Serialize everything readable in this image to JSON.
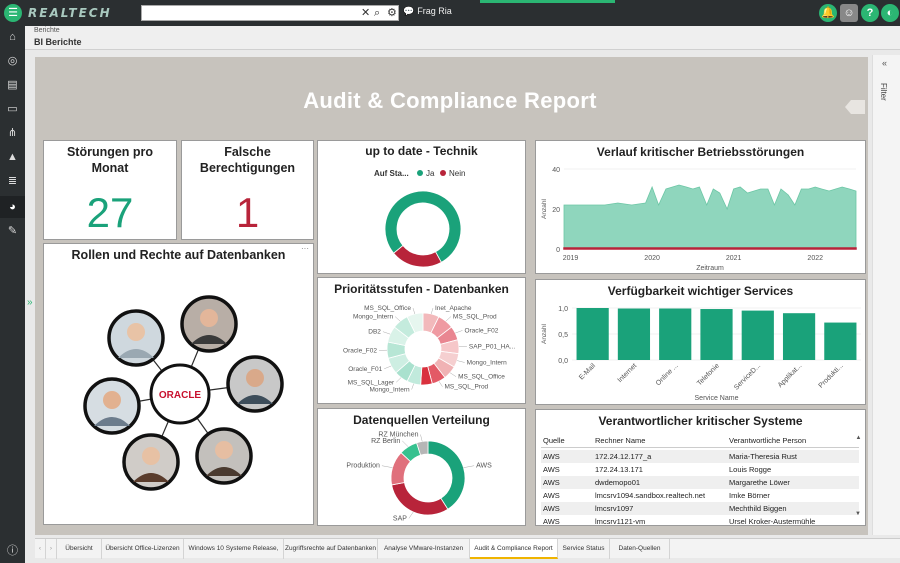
{
  "app": {
    "logo": "REALTECH",
    "search_placeholder": "",
    "ask_label": "Frag Ria"
  },
  "breadcrumb": {
    "parent": "Berichte",
    "current": "BI Berichte"
  },
  "report": {
    "title": "Audit & Compliance Report",
    "filter_label": "Filter"
  },
  "kpis": {
    "stoerungen": {
      "title_line1": "Störungen pro",
      "title_line2": "Monat",
      "value": "27",
      "color": "#1aa27a"
    },
    "berechtigungen": {
      "title_line1": "Falsche",
      "title_line2": "Berechtigungen",
      "value": "1",
      "color": "#b8243a"
    }
  },
  "rollen": {
    "title": "Rollen und Rechte auf Datenbanken",
    "center_logo": "ORACLE"
  },
  "colors": {
    "green": "#1aa27a",
    "red": "#b8243a",
    "teal_area": "#8fd6bd"
  },
  "chart_data": [
    {
      "id": "up-to-date",
      "type": "pie",
      "title": "up to date - Technik",
      "legend_title": "Auf Sta...",
      "legend": [
        "Ja",
        "Nein"
      ],
      "slices": [
        {
          "name": "Ja",
          "value": 78,
          "color": "#1aa27a"
        },
        {
          "name": "Nein",
          "value": 22,
          "color": "#b8243a"
        }
      ]
    },
    {
      "id": "verlauf",
      "type": "area",
      "title": "Verlauf kritischer Betriebsstörungen",
      "xlabel": "Zeitraum",
      "ylabel": "Anzahl",
      "x_ticks": [
        "2019",
        "2020",
        "2021",
        "2022"
      ],
      "y_ticks": [
        "0",
        "20",
        "40"
      ],
      "ylim": [
        0,
        40
      ],
      "x_range": [
        2018.92,
        2022.5
      ],
      "x": [
        2018.92,
        2019.08,
        2019.25,
        2019.42,
        2019.58,
        2019.75,
        2019.92,
        2020.0,
        2020.08,
        2020.17,
        2020.25,
        2020.33,
        2020.42,
        2020.5,
        2020.58,
        2020.67,
        2020.75,
        2020.83,
        2020.92,
        2021.0,
        2021.08,
        2021.17,
        2021.25,
        2021.33,
        2021.42,
        2021.5,
        2021.58,
        2021.67,
        2021.75,
        2021.83,
        2021.92,
        2022.0,
        2022.08,
        2022.17,
        2022.25,
        2022.33,
        2022.42,
        2022.5
      ],
      "series": [
        {
          "values": [
            22,
            22,
            22,
            22,
            23,
            22,
            23,
            31,
            22,
            30,
            31,
            32,
            31,
            30,
            31,
            22,
            30,
            28,
            20,
            30,
            31,
            28,
            29,
            30,
            30,
            22,
            30,
            27,
            22,
            30,
            30,
            31,
            30,
            29,
            30,
            31,
            30,
            29
          ],
          "color": "#8fd6bd"
        },
        {
          "values": [
            0.5,
            0.5,
            0.5,
            0.5,
            0.5,
            0.5,
            0.5,
            0.5,
            0.5,
            0.5,
            0.5,
            0.5,
            0.5,
            0.5,
            0.5,
            0.5,
            0.5,
            0.5,
            0.5,
            0.5,
            0.5,
            0.5,
            0.5,
            0.5,
            0.5,
            0.5,
            0.5,
            0.5,
            0.5,
            0.5,
            0.5,
            0.5,
            0.5,
            0.5,
            0.5,
            0.5,
            0.5,
            0.5
          ],
          "color": "#b8243a"
        }
      ]
    },
    {
      "id": "prioritaet",
      "type": "pie",
      "title": "Prioritätsstufen - Datenbanken",
      "slices": [
        {
          "name": "Inet_Apache",
          "value": 7,
          "color": "#f2b9bb"
        },
        {
          "name": "MS_SQL_Prod",
          "value": 7,
          "color": "#ef9aa2"
        },
        {
          "name": "Oracle_F02",
          "value": 6,
          "color": "#e98691"
        },
        {
          "name": "SAP_P01_HA...",
          "value": 6,
          "color": "#f6c7c9"
        },
        {
          "name": "Mongo_Intern",
          "value": 6,
          "color": "#f5cfd0"
        },
        {
          "name": "MS_SQL_Office",
          "value": 6,
          "color": "#f0b2b4"
        },
        {
          "name": "MS_SQL_Prod",
          "value": 6,
          "color": "#e35a66"
        },
        {
          "name": "",
          "value": 5,
          "color": "#d9313e"
        },
        {
          "name": "Mongo_Intern",
          "value": 6,
          "color": "#c1eadc"
        },
        {
          "name": "MS_SQL_Lager",
          "value": 6,
          "color": "#a9e1ce"
        },
        {
          "name": "Oracle_F01",
          "value": 7,
          "color": "#cdeee2"
        },
        {
          "name": "Oracle_F02",
          "value": 7,
          "color": "#b7e6d5"
        },
        {
          "name": "DB2",
          "value": 7,
          "color": "#d9f2e8"
        },
        {
          "name": "Mongo_Intern",
          "value": 7,
          "color": "#c4ebdd"
        },
        {
          "name": "MS_SQL_Office",
          "value": 7,
          "color": "#e6f6ef"
        }
      ]
    },
    {
      "id": "verfuegbarkeit",
      "type": "bar",
      "title": "Verfügbarkeit wichtiger Services",
      "xlabel": "Service Name",
      "ylabel": "Anzahl",
      "y_ticks": [
        "0,0",
        "0,5",
        "1,0"
      ],
      "ylim": [
        0,
        1
      ],
      "categories": [
        "E-Mail",
        "Internet",
        "Online ...",
        "Telefonie",
        "ServiceD...",
        "Applikat...",
        "Produkti..."
      ],
      "values": [
        1.0,
        0.99,
        0.99,
        0.98,
        0.95,
        0.9,
        0.72
      ],
      "color": "#1aa27a"
    },
    {
      "id": "datenquellen",
      "type": "pie",
      "title": "Datenquellen Verteilung",
      "slices": [
        {
          "name": "AWS",
          "value": 41,
          "color": "#1aa27a"
        },
        {
          "name": "SAP",
          "value": 31,
          "color": "#b8243a"
        },
        {
          "name": "Produktion",
          "value": 15,
          "color": "#e0707c"
        },
        {
          "name": "RZ Berlin",
          "value": 8,
          "color": "#36c18f"
        },
        {
          "name": "RZ München",
          "value": 5,
          "color": "#b6b6b6"
        }
      ]
    }
  ],
  "verantwortlicher": {
    "title": "Verantwortlicher kritischer Systeme",
    "columns": [
      "Quelle",
      "Rechner Name",
      "Verantwortliche Person"
    ],
    "rows": [
      [
        "AWS",
        "172.24.12.177_a",
        "Maria-Theresia Rust"
      ],
      [
        "AWS",
        "172.24.13.171",
        "Louis Rogge"
      ],
      [
        "AWS",
        "dwdemopo01",
        "Margarethe Löwer"
      ],
      [
        "AWS",
        "lmcsrv1094.sandbox.realtech.net",
        "Imke Börner"
      ],
      [
        "AWS",
        "lmcsrv1097",
        "Mechthild Biggen"
      ],
      [
        "AWS",
        "lmcsrv1121-vm",
        "Ursel Kroker-Austermühle"
      ]
    ]
  },
  "tabs": [
    "Übersicht",
    "Übersicht Office-Lizenzen",
    "Windows 10 Systeme Release, Patch",
    "Zugriffsrechte auf Datenbanken",
    "Analyse VMware-Instanzen",
    "Audit & Compliance Report",
    "Service Status",
    "Daten-Quellen"
  ],
  "active_tab": "Audit & Compliance Report"
}
